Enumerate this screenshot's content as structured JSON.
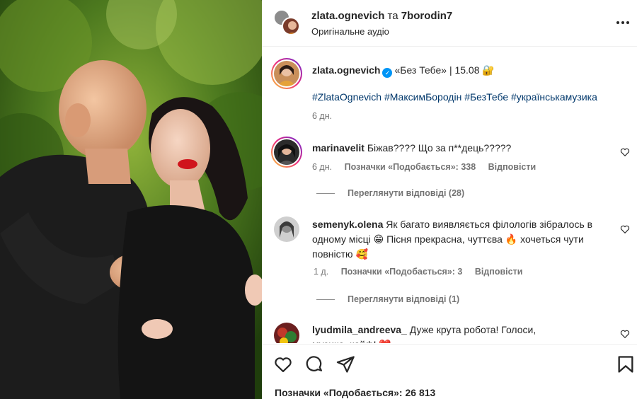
{
  "header": {
    "user1": "zlata.ognevich",
    "conjunction": "та",
    "user2": "7borodin7",
    "audio": "Оригінальне аудіо"
  },
  "caption": {
    "username": "zlata.ognevich",
    "text": "«Без Тебе» | 15.08",
    "hashtags": "#ZlataOgnevich #МаксимБородін #БезТебе #українськамузика",
    "age": "6 дн."
  },
  "comments": [
    {
      "username": "marinavelit",
      "text": "Біжав???? Що за п**дець?????",
      "age": "6 дн.",
      "likes": "Позначки «Подобається»: 338",
      "reply": "Відповісти",
      "view_replies": "Переглянути відповіді (28)"
    },
    {
      "username": "semenyk.olena",
      "text_line1": "Як багато виявляється філологів зібралось в",
      "text_line2": "одному місці 😁 Пісня прекрасна, чуттєва 🔥 хочеться чути",
      "text_line3": "повністю 🥰",
      "age": "1 д.",
      "likes": "Позначки «Подобається»: 3",
      "reply": "Відповісти",
      "view_replies": "Переглянути відповіді (1)"
    },
    {
      "username": "lyudmila_andreeva_",
      "text_line1": "Дуже крута робота! Голоси,",
      "text_line2": "музика, кайф! ❤️"
    }
  ],
  "footer": {
    "likes": "Позначки «Подобається»: 26 813"
  },
  "icons": {
    "like": "heart-icon",
    "comment": "comment-icon",
    "share": "send-icon",
    "save": "bookmark-icon",
    "more": "more-icon",
    "verified": "verified-badge-icon"
  },
  "colors": {
    "link": "#00376b",
    "verified": "#0095f6",
    "muted": "#737373"
  }
}
